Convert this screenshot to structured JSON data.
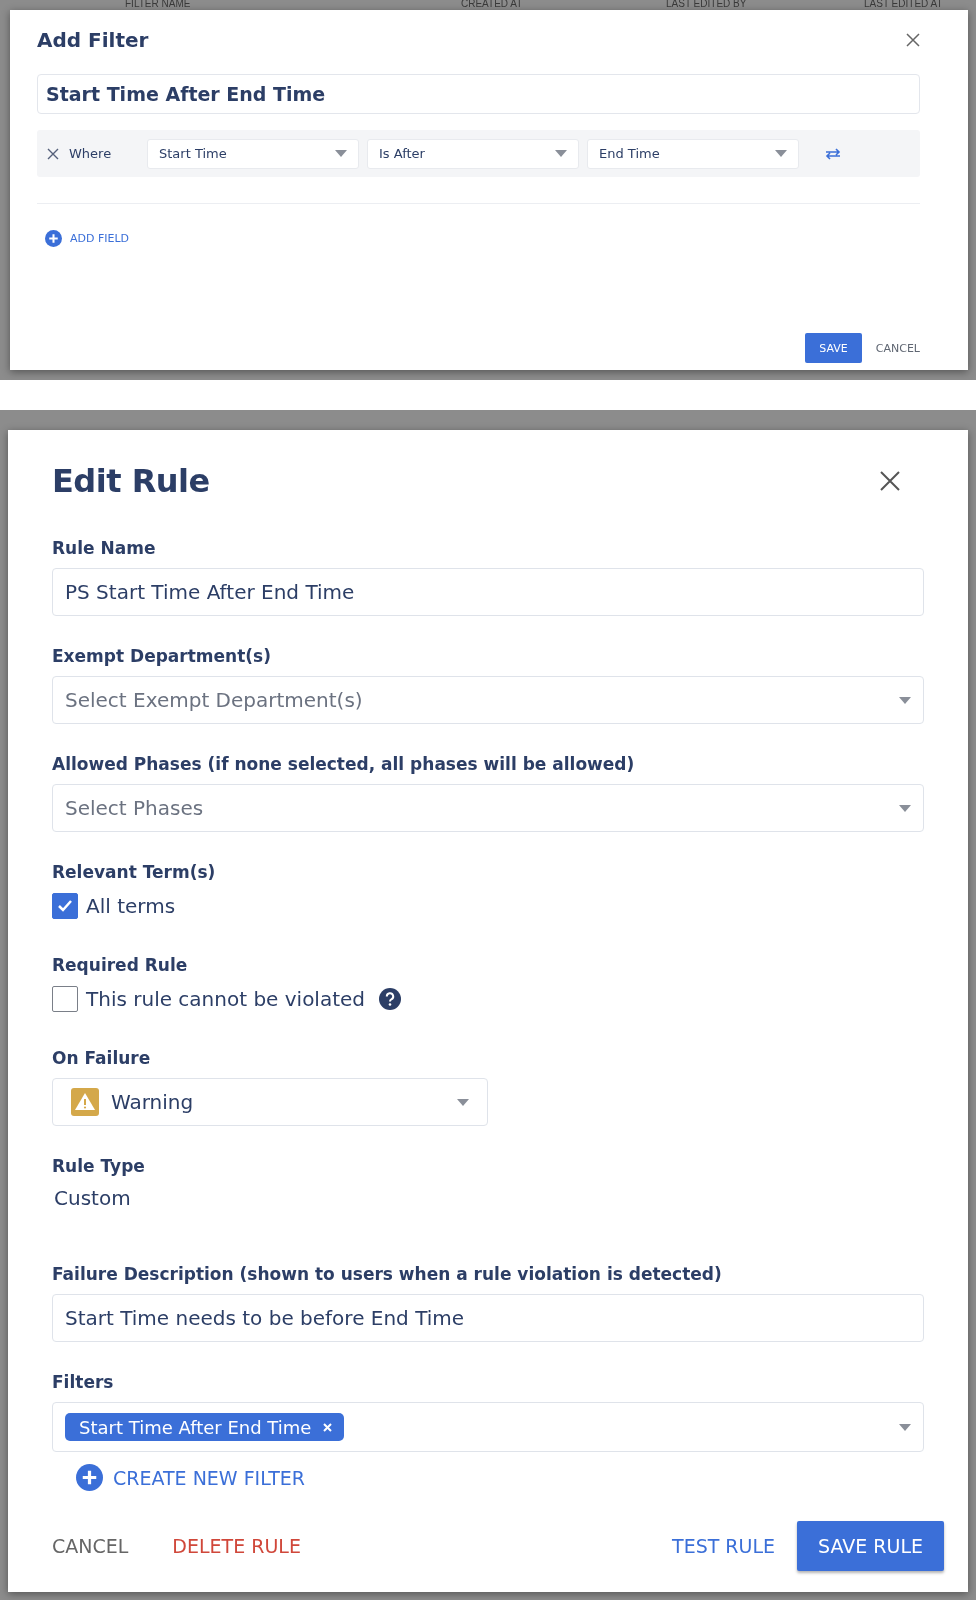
{
  "background_table": {
    "columns": [
      "FILTER NAME",
      "CREATED AT",
      "LAST EDITED BY",
      "LAST EDITED AT"
    ]
  },
  "add_filter_dialog": {
    "title": "Add Filter",
    "filter_name": "Start Time After End Time",
    "conditions": [
      {
        "prefix": "Where",
        "field": "Start Time",
        "operator": "Is After",
        "value": "End Time"
      }
    ],
    "add_field": "ADD FIELD",
    "save": "SAVE",
    "cancel": "CANCEL"
  },
  "edit_rule_dialog": {
    "title": "Edit Rule",
    "fields": [
      {
        "kind": "text",
        "label": "Rule Name",
        "value": "PS Start Time After End Time"
      },
      {
        "kind": "select",
        "label": "Exempt Department(s)",
        "placeholder": "Select Exempt Department(s)"
      },
      {
        "kind": "select",
        "label": "Allowed Phases (if none selected, all phases will be allowed)",
        "placeholder": "Select Phases"
      },
      {
        "kind": "checkbox",
        "label": "Relevant Term(s)",
        "option": "All terms",
        "checked": true,
        "help": false
      },
      {
        "kind": "checkbox",
        "label": "Required Rule",
        "option": "This rule cannot be violated",
        "checked": false,
        "help": true
      },
      {
        "kind": "severity",
        "label": "On Failure",
        "value": "Warning"
      },
      {
        "kind": "static",
        "label": "Rule Type",
        "value": "Custom"
      },
      {
        "kind": "text",
        "label": "Failure Description (shown to users when a rule violation is detected)",
        "value": "Start Time needs to be before End Time"
      },
      {
        "kind": "tags",
        "label": "Filters",
        "tags": [
          "Start Time After End Time"
        ]
      }
    ],
    "create_filter": "CREATE NEW FILTER",
    "cancel": "CANCEL",
    "delete": "DELETE RULE",
    "test": "TEST RULE",
    "save": "SAVE RULE"
  }
}
